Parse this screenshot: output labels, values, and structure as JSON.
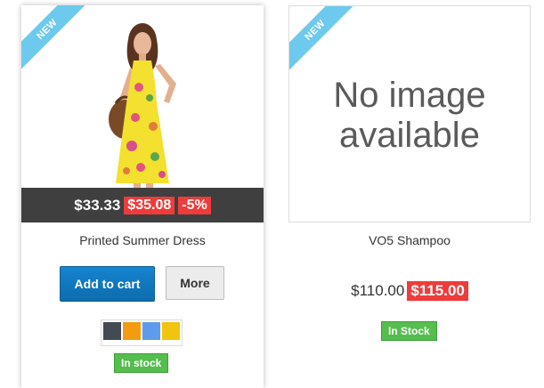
{
  "products": [
    {
      "ribbon": "NEW",
      "name": "Printed Summer Dress",
      "price": "$33.33",
      "old_price": "$35.08",
      "discount": "-5%",
      "add_to_cart_label": "Add to cart",
      "more_label": "More",
      "colors": [
        "#434a54",
        "#f39c11",
        "#5d9cec",
        "#f1c40f"
      ],
      "stock": "In stock"
    },
    {
      "ribbon": "NEW",
      "image_placeholder_line1": "No image",
      "image_placeholder_line2": "available",
      "name": "VO5 Shampoo",
      "price": "$110.00",
      "old_price": "$115.00",
      "stock": "In Stock"
    }
  ],
  "accent": {
    "ribbon": "#6ec9ee",
    "sale": "#ef3b3b",
    "button": "#1584cf",
    "stock": "#56bd4f"
  }
}
